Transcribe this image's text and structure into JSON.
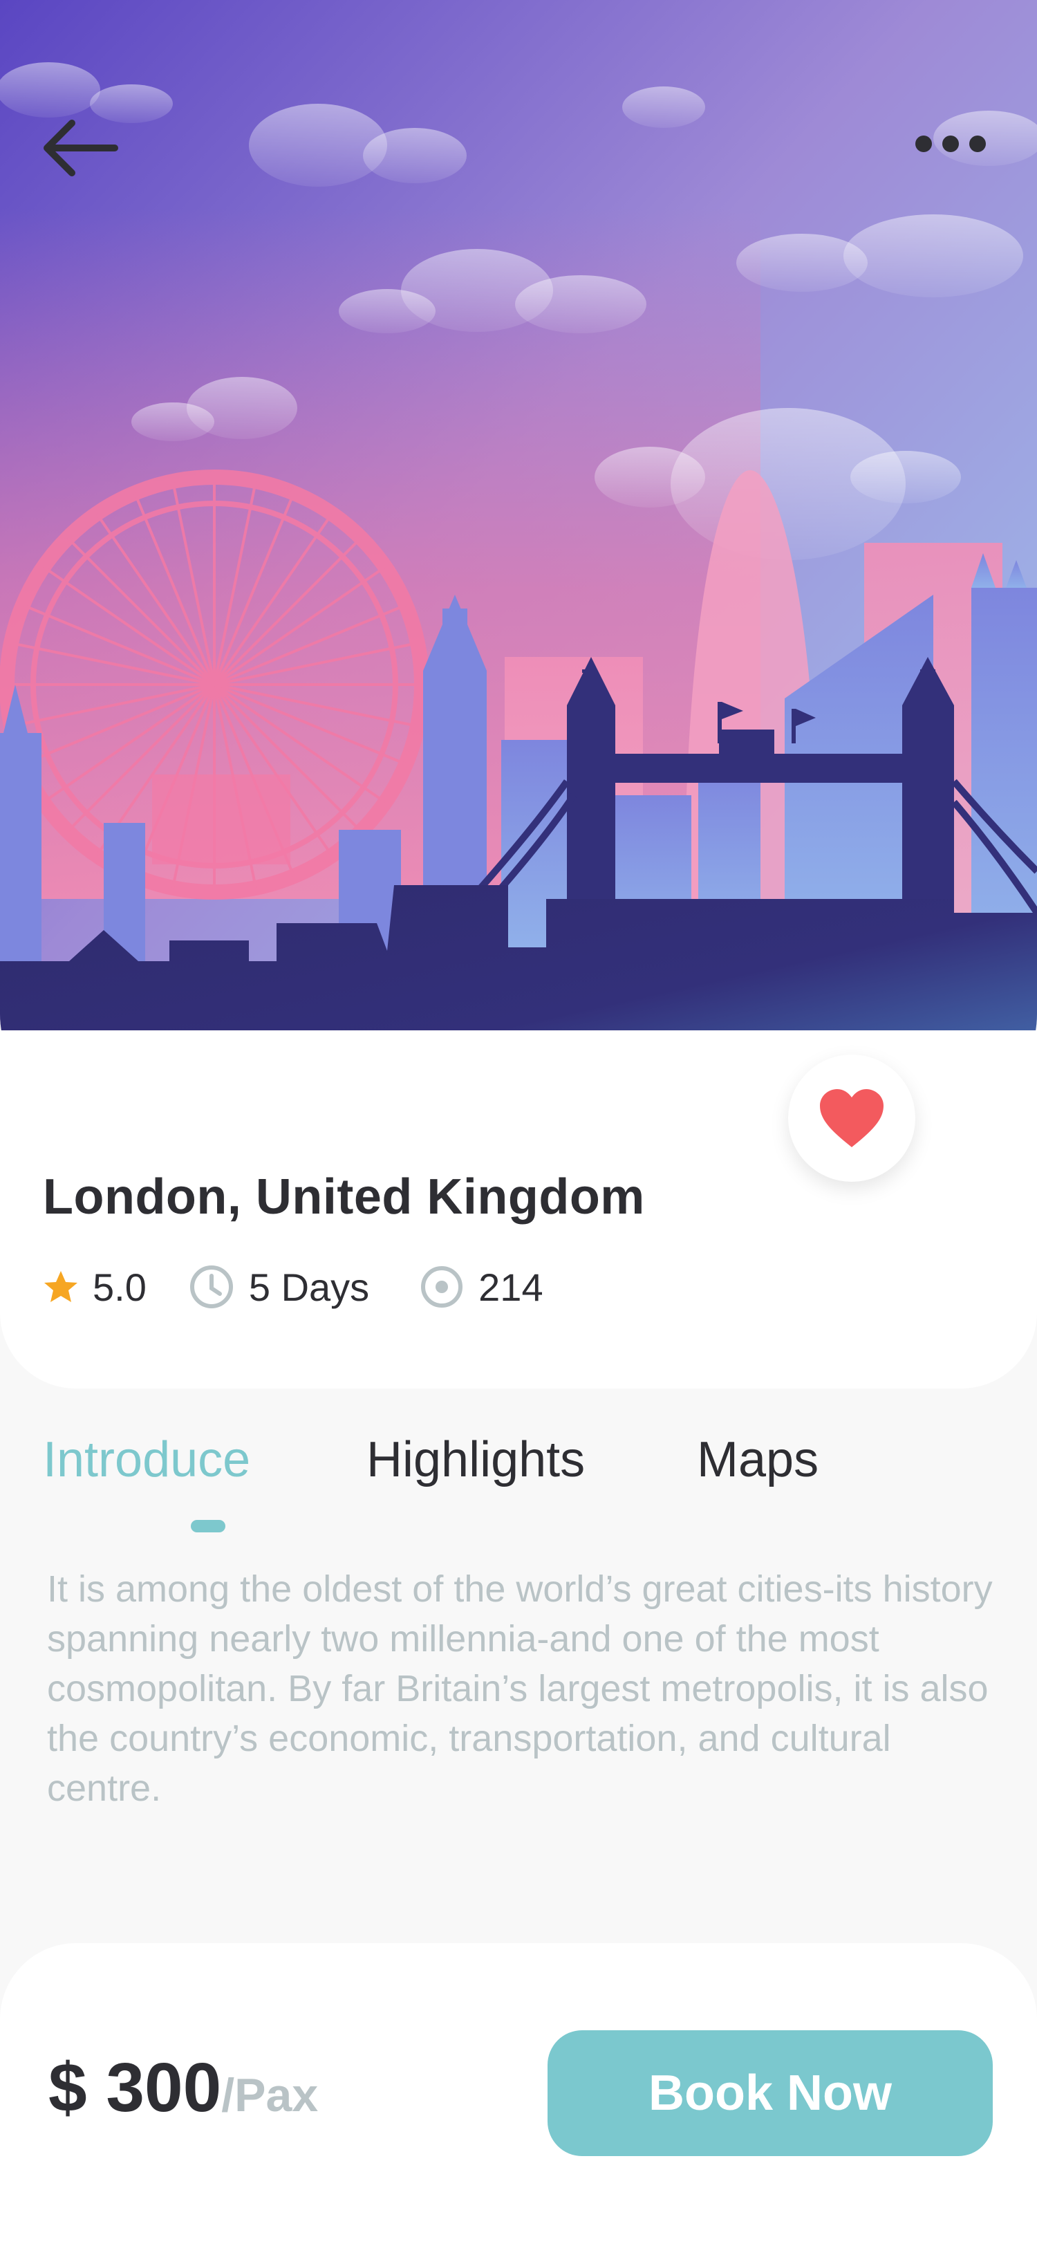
{
  "header": {
    "back_icon": "arrow-left-icon",
    "more_icon": "more-horizontal-icon"
  },
  "hero": {
    "image_subject": "london-skyline-illustration",
    "favorite_icon": "heart-icon",
    "favorite_color": "#f35a5e"
  },
  "place": {
    "title": "London, United Kingdom",
    "rating": "5.0",
    "duration": "5 Days",
    "views": "214"
  },
  "tabs": [
    {
      "label": "Introduce",
      "active": true
    },
    {
      "label": "Highlights",
      "active": false
    },
    {
      "label": "Maps",
      "active": false
    }
  ],
  "intro_text": "It is among the oldest of the world’s great cities-its history spanning nearly two millennia-and one of the most cosmopolitan. By far Britain’s largest metropolis, it is also the country’s economic, transportation, and cultural centre.",
  "booking": {
    "price": "$ 300",
    "unit": "/Pax",
    "button_label": "Book Now"
  },
  "colors": {
    "accent": "#7dc8cd",
    "text_dark": "#2e2e33",
    "text_muted": "#b9c3c6",
    "star": "#f6a623",
    "heart": "#f35a5e"
  }
}
